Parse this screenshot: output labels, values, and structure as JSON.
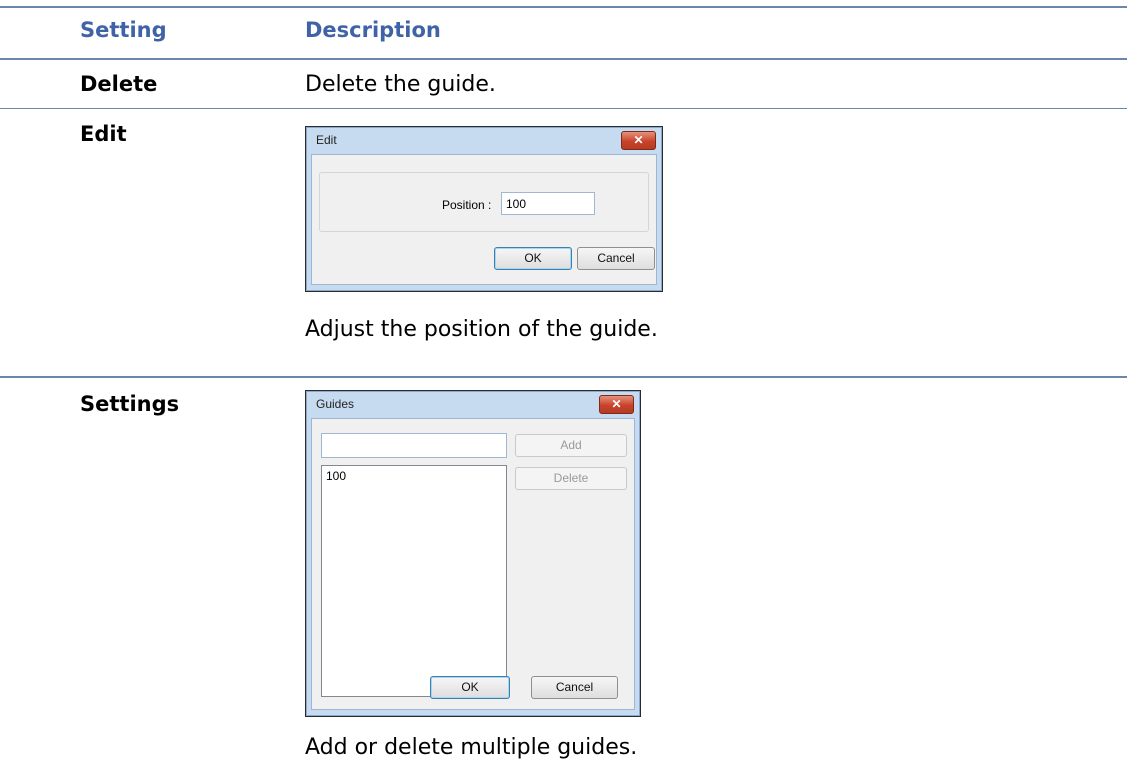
{
  "table": {
    "header": {
      "setting": "Setting",
      "description": "Description"
    },
    "rows": [
      {
        "setting": "Delete",
        "description": "Delete the guide."
      },
      {
        "setting": "Edit",
        "caption": "Adjust the position of the guide."
      },
      {
        "setting": "Settings",
        "caption": "Add or delete multiple guides."
      }
    ]
  },
  "edit_dialog": {
    "title": "Edit",
    "close": "✕",
    "position_label": "Position :",
    "position_value": "100",
    "ok": "OK",
    "cancel": "Cancel"
  },
  "guides_dialog": {
    "title": "Guides",
    "close": "✕",
    "input_value": "",
    "add": "Add",
    "delete": "Delete",
    "list_items": [
      "100"
    ],
    "ok": "OK",
    "cancel": "Cancel"
  },
  "colors": {
    "header_text": "#3f63a6",
    "rule": "#6b86ad"
  }
}
